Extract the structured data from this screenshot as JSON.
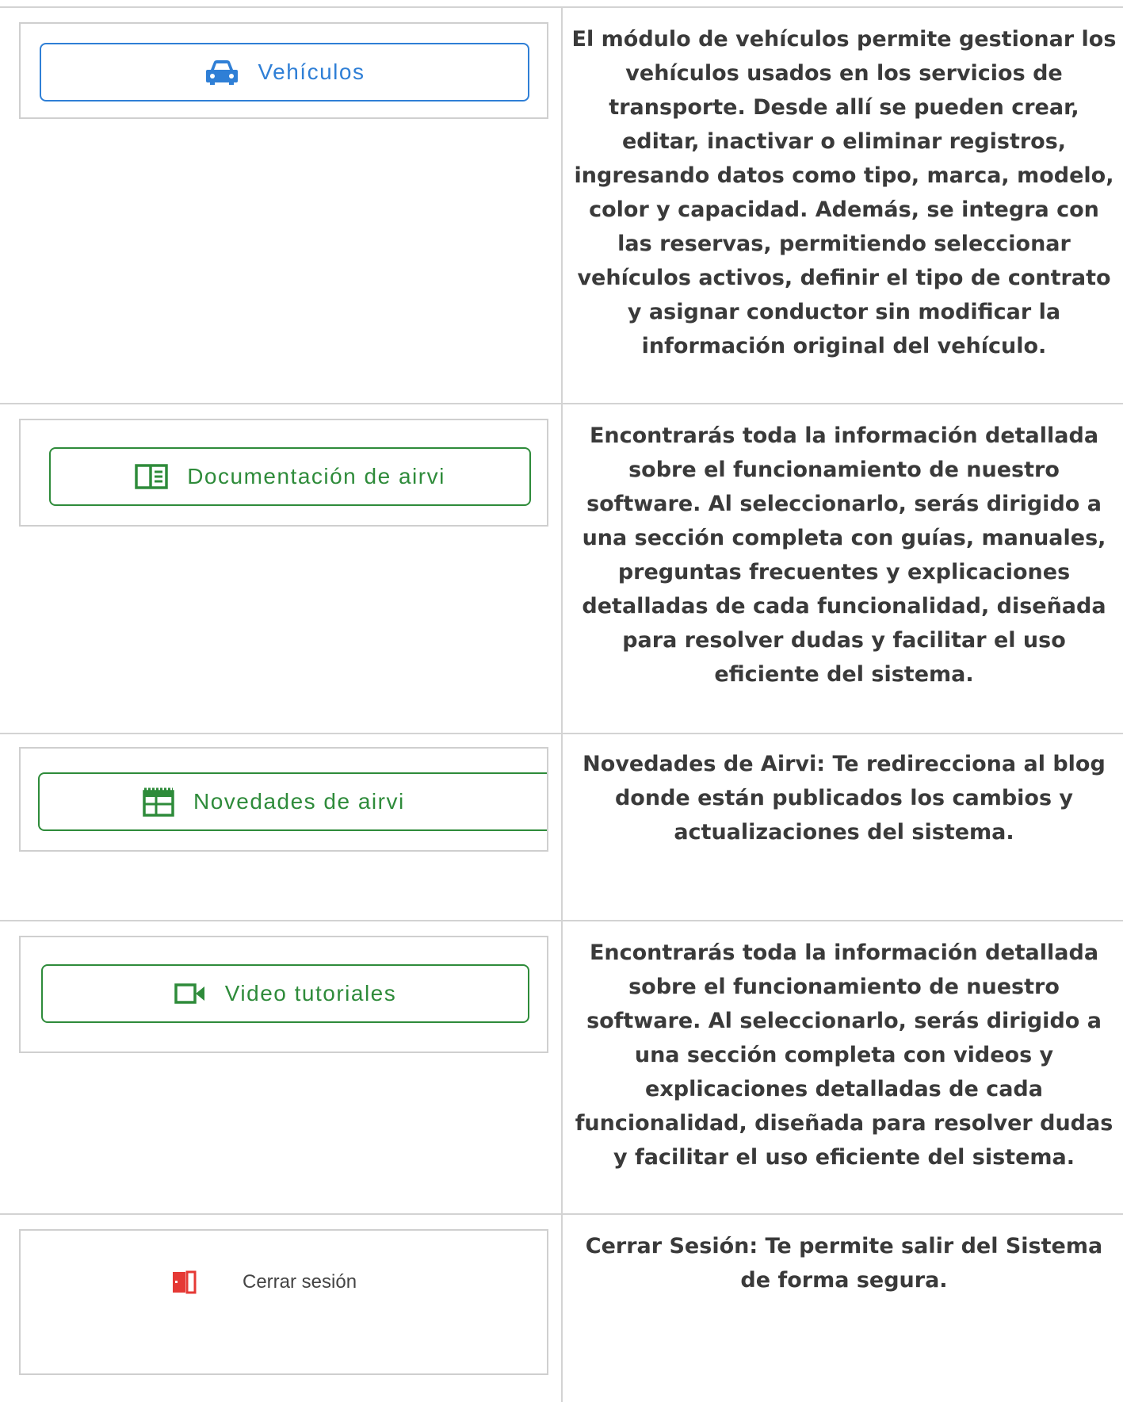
{
  "rows": [
    {
      "button_label": "Vehículos",
      "icon": "car-icon",
      "color": "#2f7fd6",
      "description": "El módulo de vehículos permite gestionar los vehículos usados en los servicios de transporte. Desde allí se pueden crear, editar, inactivar o eliminar registros, ingresando datos como tipo, marca, modelo, color y capacidad. Además, se integra con las reservas, permitiendo seleccionar vehículos activos, definir el tipo de contrato y asignar conductor sin modificar la información original del vehículo."
    },
    {
      "button_label": "Documentación de airvi",
      "icon": "book-icon",
      "color": "#2e8b3a",
      "description": "Encontrarás toda la información detallada sobre el funcionamiento de nuestro software. Al seleccionarlo, serás dirigido a una sección completa con guías, manuales, preguntas frecuentes y explicaciones detalladas de cada funcionalidad, diseñada para resolver dudas y facilitar el uso eficiente del sistema."
    },
    {
      "button_label": "Novedades de airvi",
      "icon": "newspaper-icon",
      "color": "#2e8b3a",
      "description": "Novedades de Airvi: Te redirecciona al blog donde están publicados los cambios y actualizaciones del sistema."
    },
    {
      "button_label": "Video tutoriales",
      "icon": "video-camera-icon",
      "color": "#2e8b3a",
      "description": "Encontrarás toda la información detallada sobre el funcionamiento de nuestro software. Al seleccionarlo, serás dirigido a una sección completa con videos y explicaciones detalladas de cada funcionalidad, diseñada para resolver dudas y facilitar el uso eficiente del sistema."
    },
    {
      "button_label": "Cerrar sesión",
      "icon": "door-exit-icon",
      "color": "#e53935",
      "description": "Cerrar Sesión: Te permite salir del Sistema de forma segura."
    }
  ]
}
